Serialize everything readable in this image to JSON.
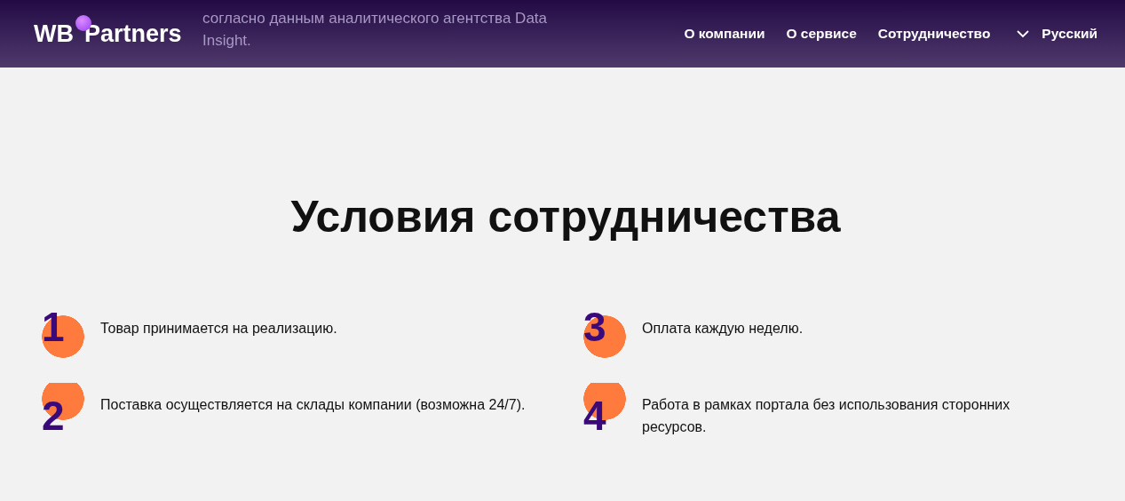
{
  "header": {
    "logo": {
      "left": "WB",
      "right": "Partners"
    },
    "covered_text": "согласно данным аналитического агентства Data Insight.",
    "nav": [
      "О компании",
      "О сервисе",
      "Сотрудничество"
    ],
    "language": "Русский"
  },
  "section": {
    "title": "Условия сотрудничества",
    "items": [
      {
        "number": "1",
        "text": "Товар принимается на реализацию.",
        "kind": "low"
      },
      {
        "number": "2",
        "text": "Поставка осуществляется на склады компании (возможна 24/7).",
        "kind": "high"
      },
      {
        "number": "3",
        "text": "Оплата каждую неделю.",
        "kind": "low"
      },
      {
        "number": "4",
        "text": "Работа в рамках портала без использования сторонних ресурсов.",
        "kind": "high"
      }
    ]
  }
}
